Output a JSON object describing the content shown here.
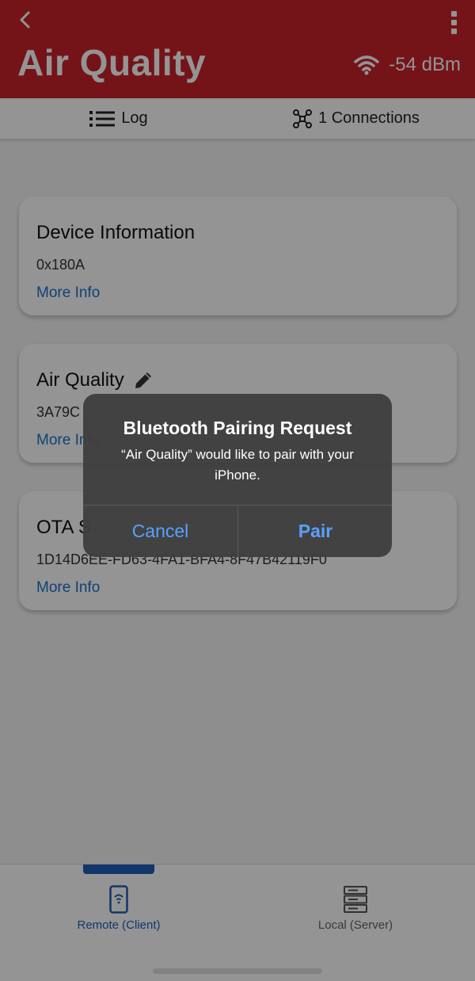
{
  "header": {
    "title": "Air Quality",
    "rssi": "-54 dBm",
    "color": "#c8242b"
  },
  "tabs": {
    "log_label": "Log",
    "connections_label": "1 Connections"
  },
  "services": [
    {
      "name": "Device Information",
      "uuid": "0x180A",
      "link": "More Info"
    },
    {
      "name": "Air Quality",
      "uuid": "3A79C",
      "link": "More Info"
    },
    {
      "name": "OTA S",
      "uuid": "1D14D6EE-FD63-4FA1-BFA4-8F47B42119F0",
      "link": "More Info"
    }
  ],
  "bottom_nav": {
    "remote_label": "Remote (Client)",
    "local_label": "Local (Server)",
    "active_color": "#1f5db8"
  },
  "alert": {
    "title": "Bluetooth Pairing Request",
    "message": "“Air Quality” would like to pair with your iPhone.",
    "cancel_label": "Cancel",
    "pair_label": "Pair"
  }
}
